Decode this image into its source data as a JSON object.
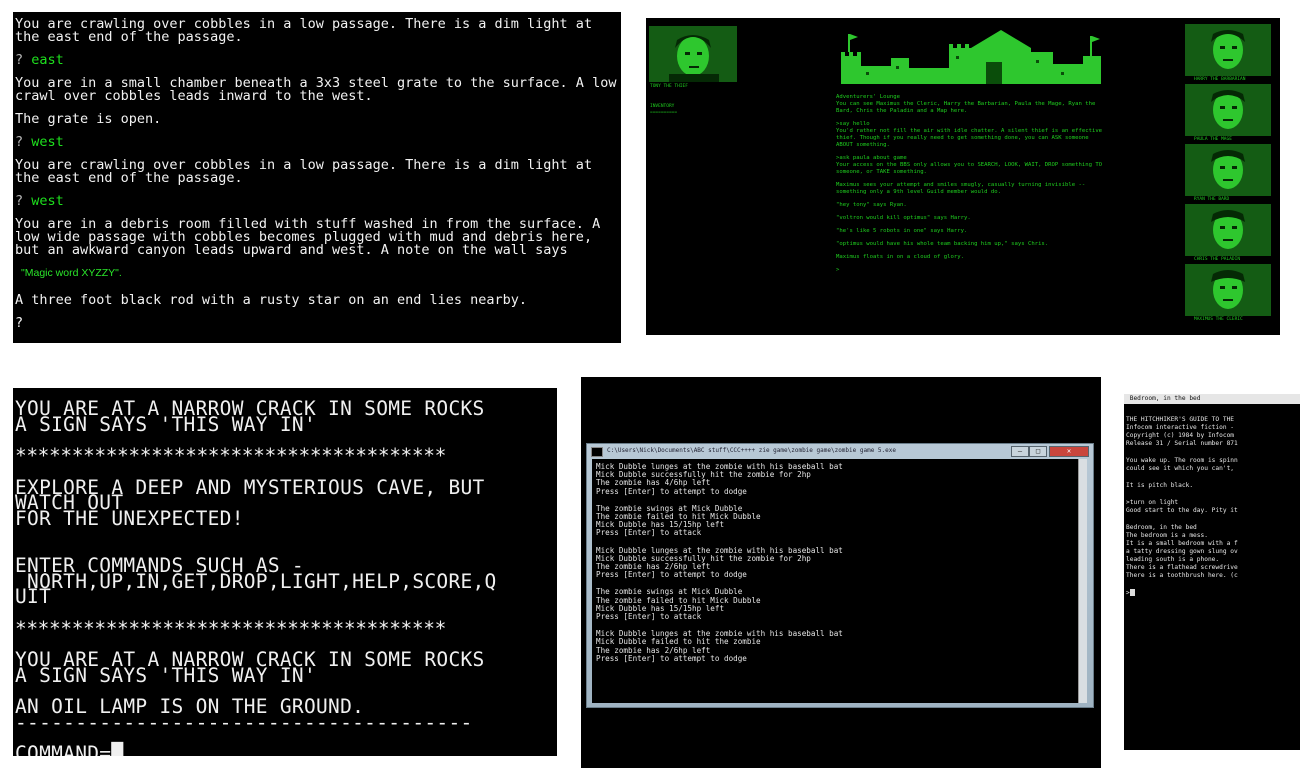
{
  "panel1": {
    "paragraphs": [
      {
        "type": "text",
        "text": "You are crawling over cobbles in a low passage. There is a dim light at the east end of the passage."
      },
      {
        "type": "cmd",
        "prompt": "?",
        "command": "east"
      },
      {
        "type": "text",
        "text": "You are in a small chamber beneath a 3x3 steel grate to the surface. A low crawl over cobbles leads inward to the west."
      },
      {
        "type": "text",
        "text": "The grate is open."
      },
      {
        "type": "cmd",
        "prompt": "?",
        "command": "west"
      },
      {
        "type": "text",
        "text": "You are crawling over cobbles in a low passage. There is a dim light at the east end of the passage."
      },
      {
        "type": "cmd",
        "prompt": "?",
        "command": "west"
      },
      {
        "type": "text",
        "text": "You are in a debris room filled with stuff washed in from the surface. A low wide passage with cobbles becomes plugged with mud and debris here, but an awkward canyon leads upward and west. A note on the wall says"
      },
      {
        "type": "note",
        "text": "\"Magic word XYZZY\"."
      },
      {
        "type": "text",
        "text": "A three foot black rod with a rusty star on an end lies nearby."
      },
      {
        "type": "text",
        "text": "?"
      }
    ]
  },
  "panel2": {
    "left_caption": "TONY THE THIEF",
    "left_menu": [
      "INVENTORY",
      "=========="
    ],
    "story": [
      "Adventurers' Lounge\nYou can see Maximus the Cleric, Harry the Barbarian, Paula the Mage, Ryan the Bard, Chris the Paladin and a Map here.",
      ">say hello\nYou'd rather not fill the air with idle chatter. A silent thief is an effective thief. Though if you really need to get something done, you can ASK someone ABOUT something.",
      ">ask paula about game\nYour access on the BBS only allows you to SEARCH, LOOK, WAIT, DROP something TO someone, or TAKE something.",
      "Maximus sees your attempt and smiles smugly, casually turning invisible -- something only a 9th level Guild member would do.",
      "\"hey tony\" says Ryan.",
      "\"voltron would kill optimus\" says Harry.",
      "\"he's like 5 robots in one\" says Harry.",
      "\"optimus would have his whole team backing him up,\" says Chris.",
      "Maximus floats in on a cloud of glory.",
      ">"
    ],
    "right_captions": [
      "HARRY THE BARBARIAN",
      "PAULA THE MAGE",
      "RYAN THE BARD",
      "CHRIS THE PALADIN",
      "MAXIMUS THE CLERIC"
    ]
  },
  "panel3": {
    "lines": [
      "YOU ARE AT A NARROW CRACK IN SOME ROCKS",
      "A SIGN SAYS 'THIS WAY IN'",
      "",
      "**************************************",
      "",
      "EXPLORE A DEEP AND MYSTERIOUS CAVE, BUT",
      "WATCH OUT",
      "FOR THE UNEXPECTED!",
      "",
      "",
      "ENTER COMMANDS SUCH AS -",
      " NORTH,UP,IN,GET,DROP,LIGHT,HELP,SCORE,Q",
      "UIT",
      "",
      "**************************************",
      "",
      "YOU ARE AT A NARROW CRACK IN SOME ROCKS",
      "A SIGN SAYS 'THIS WAY IN'",
      "",
      "AN OIL LAMP IS ON THE GROUND.",
      "--------------------------------------",
      "",
      "COMMAND=█"
    ]
  },
  "panel4": {
    "window_title": "C:\\Users\\Nick\\Documents\\ABC stuff\\CCC++++ zie game\\zombie game\\zombie game 5.exe",
    "buttons": [
      "–",
      "□",
      "✕"
    ],
    "blocks": [
      "Mick Dubble lunges at the zombie with his baseball bat\nMick Dubble successfully hit the zombie for 2hp\nThe zombie has 4/6hp left\nPress [Enter] to attempt to dodge",
      "The zombie swings at Mick Dubble\nThe zombie failed to hit Mick Dubble\nMick Dubble has 15/15hp left\nPress [Enter] to attack",
      "Mick Dubble lunges at the zombie with his baseball bat\nMick Dubble successfully hit the zombie for 2hp\nThe zombie has 2/6hp left\nPress [Enter] to attempt to dodge",
      "The zombie swings at Mick Dubble\nThe zombie failed to hit Mick Dubble\nMick Dubble has 15/15hp left\nPress [Enter] to attack",
      "Mick Dubble lunges at the zombie with his baseball bat\nMick Dubble failed to hit the zombie\nThe zombie has 2/6hp left\nPress [Enter] to attempt to dodge"
    ]
  },
  "panel5": {
    "status_bar": " Bedroom, in the bed",
    "blocks": [
      "THE HITCHHIKER'S GUIDE TO THE\nInfocom interactive fiction -\nCopyright (c) 1984 by Infocom\nRelease 31 / Serial number 871",
      "You wake up. The room is spinn\ncould see it which you can't,",
      "It is pitch black.",
      ">turn on light\nGood start to the day. Pity it",
      "Bedroom, in the bed\nThe bedroom is a mess.\nIt is a small bedroom with a f\na tatty dressing gown slung ov\nleading south is a phone.\nThere is a flathead screwdrive\nThere is a toothbrush here. (c"
    ],
    "prompt": ">"
  },
  "colors": {
    "green": "#1fcf1f",
    "dark_green": "#0a5a0a",
    "amber_text": "#f0f0f0"
  }
}
